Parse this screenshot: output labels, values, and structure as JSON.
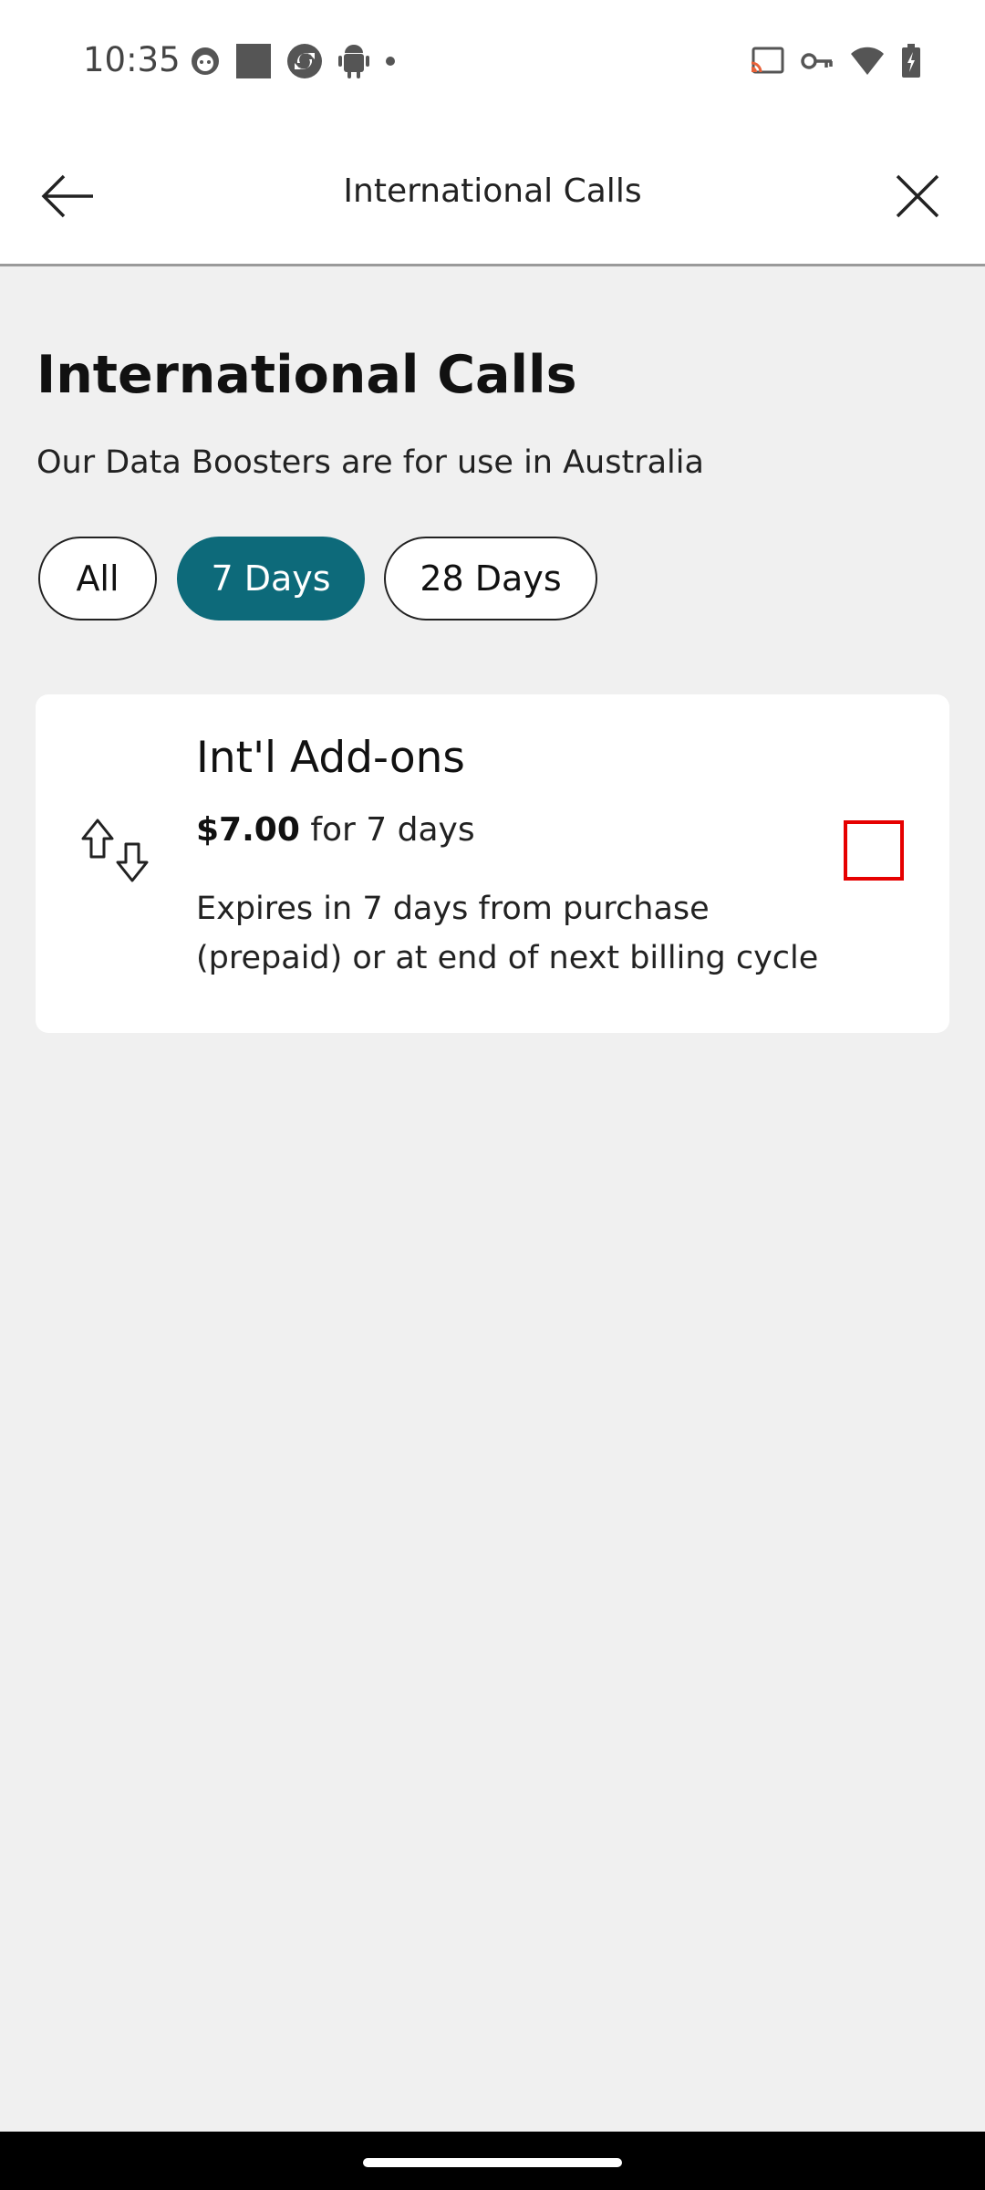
{
  "status_bar": {
    "time": "10:35",
    "left_icons": [
      "cat-notification-icon",
      "square-notification-icon",
      "sync-notification-icon",
      "android-notification-icon",
      "dot-icon"
    ],
    "right_icons": [
      "cast-icon",
      "vpn-key-icon",
      "wifi-icon",
      "battery-charging-icon"
    ]
  },
  "app_bar": {
    "title": "International Calls",
    "back_icon": "arrow-left-icon",
    "close_icon": "close-icon"
  },
  "page": {
    "title": "International Calls",
    "subtitle": "Our Data Boosters are for use in Australia"
  },
  "filters": {
    "selected": "7 Days",
    "items": [
      {
        "label": "All"
      },
      {
        "label": "7 Days"
      },
      {
        "label": "28 Days"
      }
    ]
  },
  "addon_card": {
    "icon": "swap-vertical-arrows-icon",
    "title": "Int'l Add-ons",
    "price": "$7.00",
    "price_suffix": " for 7 days",
    "description": "Expires in 7 days from purchase (prepaid) or at end of next billing cycle",
    "checked": false
  },
  "colors": {
    "accent": "#0d6a7a",
    "checkbox_border": "#e60000",
    "background": "#f0f0f0"
  }
}
